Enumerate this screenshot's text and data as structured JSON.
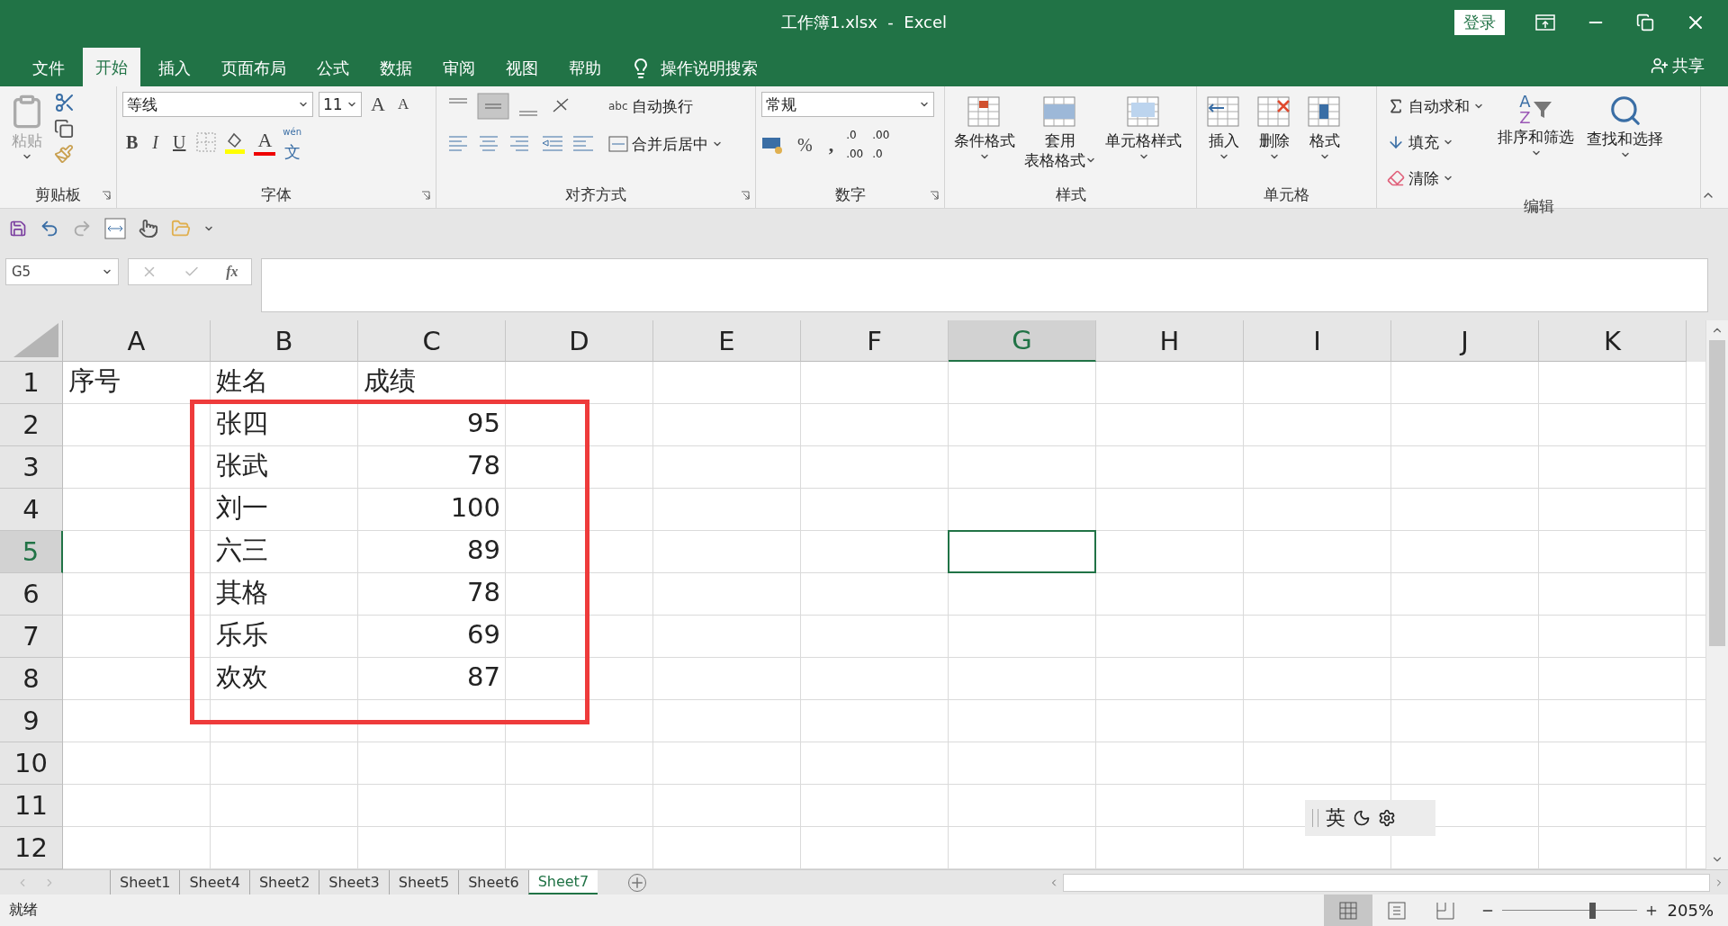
{
  "window": {
    "title": "工作簿1.xlsx  -  Excel",
    "sign_in": "登录",
    "share": "共享"
  },
  "menu_tabs": [
    {
      "label": "文件",
      "selected": false
    },
    {
      "label": "开始",
      "selected": true
    },
    {
      "label": "插入",
      "selected": false
    },
    {
      "label": "页面布局",
      "selected": false
    },
    {
      "label": "公式",
      "selected": false
    },
    {
      "label": "数据",
      "selected": false
    },
    {
      "label": "审阅",
      "selected": false
    },
    {
      "label": "视图",
      "selected": false
    },
    {
      "label": "帮助",
      "selected": false
    }
  ],
  "tell_me": {
    "placeholder": "操作说明搜索"
  },
  "ribbon": {
    "clipboard": {
      "label": "剪贴板",
      "paste": "粘贴"
    },
    "font": {
      "label": "字体",
      "font_name": "等线",
      "font_size": "11",
      "grow": "A",
      "shrink": "A",
      "bold": "B",
      "italic": "I",
      "underline": "U",
      "font_color": "A",
      "phonetic_top": "wén",
      "phonetic_bottom": "文"
    },
    "alignment": {
      "label": "对齐方式",
      "wrap_icon": "abc",
      "wrap": "自动换行",
      "merge": "合并后居中"
    },
    "number": {
      "label": "数字",
      "format": "常规",
      "percent": "%",
      "comma": ",",
      "increase_decimal": [
        ".0",
        ".00"
      ],
      "decrease_decimal": [
        ".00",
        ".0"
      ]
    },
    "styles": {
      "label": "样式",
      "buttons": [
        {
          "lines": [
            "条件格式"
          ],
          "kind": "conditional"
        },
        {
          "lines": [
            "套用",
            "表格格式"
          ],
          "kind": "table"
        },
        {
          "lines": [
            "单元格样式"
          ],
          "kind": "cell"
        }
      ]
    },
    "cells": {
      "label": "单元格",
      "buttons": [
        {
          "label": "插入",
          "kind": "insert"
        },
        {
          "label": "删除",
          "kind": "delete"
        },
        {
          "label": "格式",
          "kind": "format"
        }
      ]
    },
    "editing": {
      "label": "编辑",
      "small": [
        {
          "label": "自动求和",
          "kind": "sum"
        },
        {
          "label": "填充",
          "kind": "fill"
        },
        {
          "label": "清除",
          "kind": "clear"
        }
      ],
      "sort": {
        "letters": [
          "A",
          "Z"
        ],
        "label": "排序和筛选"
      },
      "find": "查找和选择"
    }
  },
  "name_box": "G5",
  "function_label": "fx",
  "columns": [
    {
      "label": "A",
      "selected": false
    },
    {
      "label": "B",
      "selected": false
    },
    {
      "label": "C",
      "selected": false
    },
    {
      "label": "D",
      "selected": false
    },
    {
      "label": "E",
      "selected": false
    },
    {
      "label": "F",
      "selected": false
    },
    {
      "label": "G",
      "selected": true
    },
    {
      "label": "H",
      "selected": false
    },
    {
      "label": "I",
      "selected": false
    },
    {
      "label": "J",
      "selected": false
    },
    {
      "label": "K",
      "selected": false
    }
  ],
  "rows": [
    {
      "label": "1",
      "selected": false,
      "cells": [
        {
          "text": "序号",
          "kind": "text"
        },
        {
          "text": "姓名",
          "kind": "text"
        },
        {
          "text": "成绩",
          "kind": "text"
        }
      ]
    },
    {
      "label": "2",
      "selected": false,
      "cells": [
        null,
        {
          "text": "张四",
          "kind": "text"
        },
        {
          "text": "95",
          "kind": "number"
        }
      ]
    },
    {
      "label": "3",
      "selected": false,
      "cells": [
        null,
        {
          "text": "张武",
          "kind": "text"
        },
        {
          "text": "78",
          "kind": "number"
        }
      ]
    },
    {
      "label": "4",
      "selected": false,
      "cells": [
        null,
        {
          "text": "刘一",
          "kind": "text"
        },
        {
          "text": "100",
          "kind": "number"
        }
      ]
    },
    {
      "label": "5",
      "selected": true,
      "cells": [
        null,
        {
          "text": "六三",
          "kind": "text"
        },
        {
          "text": "89",
          "kind": "number"
        }
      ]
    },
    {
      "label": "6",
      "selected": false,
      "cells": [
        null,
        {
          "text": "其格",
          "kind": "text"
        },
        {
          "text": "78",
          "kind": "number"
        }
      ]
    },
    {
      "label": "7",
      "selected": false,
      "cells": [
        null,
        {
          "text": "乐乐",
          "kind": "text"
        },
        {
          "text": "69",
          "kind": "number"
        }
      ]
    },
    {
      "label": "8",
      "selected": false,
      "cells": [
        null,
        {
          "text": "欢欢",
          "kind": "text"
        },
        {
          "text": "87",
          "kind": "number"
        }
      ]
    },
    {
      "label": "9",
      "selected": false
    },
    {
      "label": "10",
      "selected": false
    },
    {
      "label": "11",
      "selected": false
    },
    {
      "label": "12",
      "selected": false
    }
  ],
  "sheets": [
    {
      "label": "Sheet1",
      "selected": false
    },
    {
      "label": "Sheet4",
      "selected": false
    },
    {
      "label": "Sheet2",
      "selected": false
    },
    {
      "label": "Sheet3",
      "selected": false
    },
    {
      "label": "Sheet5",
      "selected": false
    },
    {
      "label": "Sheet6",
      "selected": false
    },
    {
      "label": "Sheet7",
      "selected": true
    }
  ],
  "status": "就绪",
  "views": [
    {
      "kind": "normal",
      "selected": true
    },
    {
      "kind": "page_layout",
      "selected": false
    },
    {
      "kind": "page_break",
      "selected": false
    }
  ],
  "zoom": {
    "level": 0.67,
    "reading": "205%"
  },
  "ime": {
    "label": "英"
  }
}
